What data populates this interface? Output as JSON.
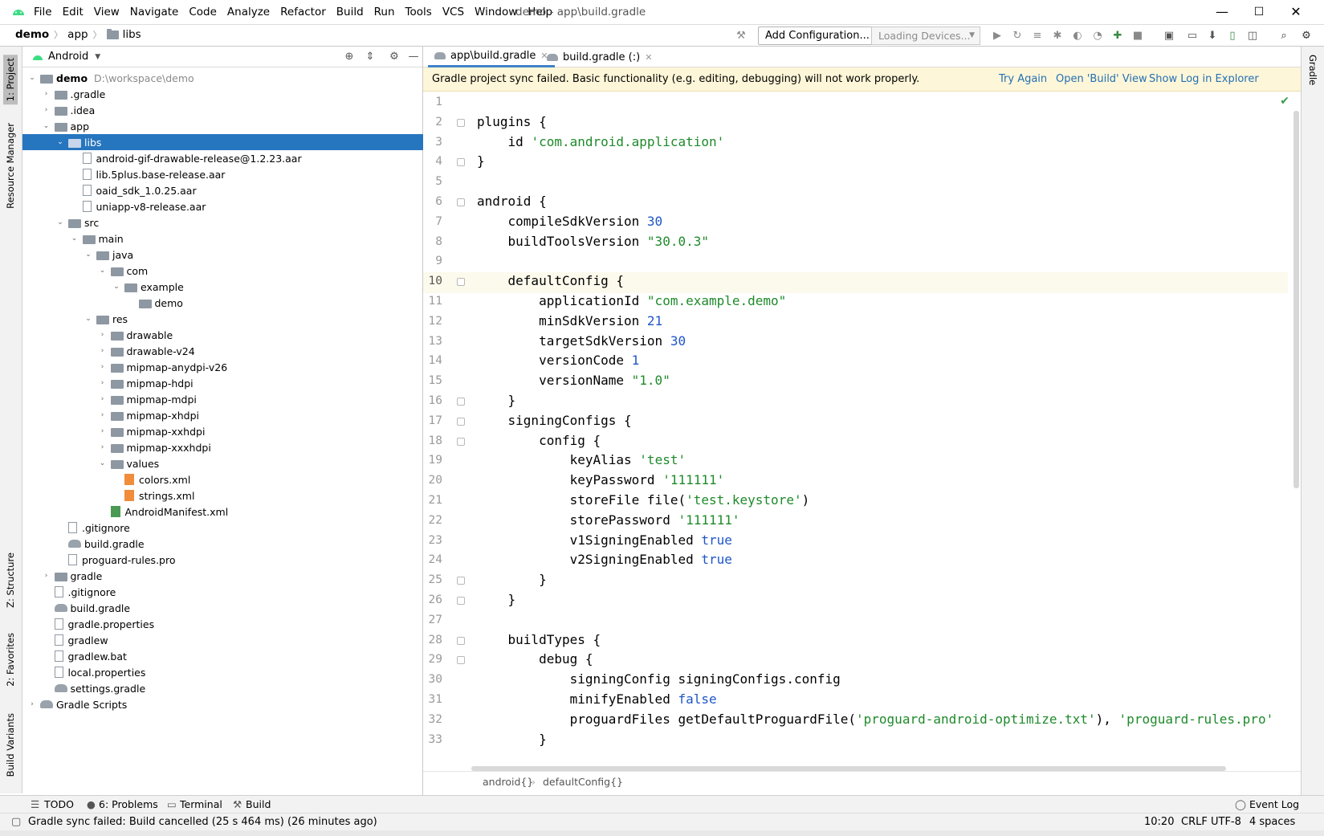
{
  "window": {
    "title": "demo - app\\build.gradle",
    "menu": [
      "File",
      "Edit",
      "View",
      "Navigate",
      "Code",
      "Analyze",
      "Refactor",
      "Build",
      "Run",
      "Tools",
      "VCS",
      "Window",
      "Help"
    ],
    "minimize": "—",
    "maximize": "☐",
    "close": "✕"
  },
  "navbar": {
    "breadcrumb": [
      "demo",
      "app",
      "libs"
    ],
    "add_configuration": "Add Configuration...",
    "devices": "Loading Devices..."
  },
  "leftstrip": {
    "project": "1: Project",
    "resource_manager": "Resource Manager",
    "structure": "Z: Structure",
    "favorites": "2: Favorites",
    "build_variants": "Build Variants"
  },
  "project_panel": {
    "view_mode": "Android",
    "tree": [
      {
        "label": "demo",
        "path": "D:\\workspace\\demo",
        "bold": true
      },
      {
        "label": ".gradle"
      },
      {
        "label": ".idea"
      },
      {
        "label": "app"
      },
      {
        "label": "libs"
      },
      {
        "label": "android-gif-drawable-release@1.2.23.aar"
      },
      {
        "label": "lib.5plus.base-release.aar"
      },
      {
        "label": "oaid_sdk_1.0.25.aar"
      },
      {
        "label": "uniapp-v8-release.aar"
      },
      {
        "label": "src"
      },
      {
        "label": "main"
      },
      {
        "label": "java"
      },
      {
        "label": "com"
      },
      {
        "label": "example"
      },
      {
        "label": "demo"
      },
      {
        "label": "res"
      },
      {
        "label": "drawable"
      },
      {
        "label": "drawable-v24"
      },
      {
        "label": "mipmap-anydpi-v26"
      },
      {
        "label": "mipmap-hdpi"
      },
      {
        "label": "mipmap-mdpi"
      },
      {
        "label": "mipmap-xhdpi"
      },
      {
        "label": "mipmap-xxhdpi"
      },
      {
        "label": "mipmap-xxxhdpi"
      },
      {
        "label": "values"
      },
      {
        "label": "colors.xml"
      },
      {
        "label": "strings.xml"
      },
      {
        "label": "AndroidManifest.xml"
      },
      {
        "label": ".gitignore"
      },
      {
        "label": "build.gradle"
      },
      {
        "label": "proguard-rules.pro"
      },
      {
        "label": "gradle"
      },
      {
        "label": ".gitignore"
      },
      {
        "label": "build.gradle"
      },
      {
        "label": "gradle.properties"
      },
      {
        "label": "gradlew"
      },
      {
        "label": "gradlew.bat"
      },
      {
        "label": "local.properties"
      },
      {
        "label": "settings.gradle"
      },
      {
        "label": "Gradle Scripts"
      }
    ]
  },
  "editor": {
    "tabs": [
      {
        "label": "app\\build.gradle",
        "active": true
      },
      {
        "label": "build.gradle (:)",
        "active": false
      }
    ],
    "banner": {
      "message": "Gradle project sync failed. Basic functionality (e.g. editing, debugging) will not work properly.",
      "try_again": "Try Again",
      "open_build_view": "Open 'Build' View",
      "show_log": "Show Log in Explorer"
    },
    "code_lines": [
      "",
      "plugins {",
      "    id 'com.android.application'",
      "}",
      "",
      "android {",
      "    compileSdkVersion 30",
      "    buildToolsVersion \"30.0.3\"",
      "",
      "    defaultConfig {",
      "        applicationId \"com.example.demo\"",
      "        minSdkVersion 21",
      "        targetSdkVersion 30",
      "        versionCode 1",
      "        versionName \"1.0\"",
      "    }",
      "    signingConfigs {",
      "        config {",
      "            keyAlias 'test'",
      "            keyPassword '111111'",
      "            storeFile file('test.keystore')",
      "            storePassword '111111'",
      "            v1SigningEnabled true",
      "            v2SigningEnabled true",
      "        }",
      "    }",
      "",
      "    buildTypes {",
      "        debug {",
      "            signingConfig signingConfigs.config",
      "            minifyEnabled false",
      "            proguardFiles getDefaultProguardFile('proguard-android-optimize.txt'), 'proguard-rules.pro'",
      "        }"
    ],
    "current_line": 10,
    "crumbs": [
      "android{}",
      "defaultConfig{}"
    ]
  },
  "rightstrip": {
    "gradle": "Gradle"
  },
  "bottom_tools": {
    "todo": "TODO",
    "problems": "6: Problems",
    "terminal": "Terminal",
    "build": "Build",
    "event_log": "Event Log"
  },
  "status": {
    "message": "Gradle sync failed: Build cancelled (25 s 464 ms) (26 minutes ago)",
    "position": "10:20",
    "line_sep": "CRLF",
    "encoding": "UTF-8",
    "indent": "4 spaces"
  }
}
